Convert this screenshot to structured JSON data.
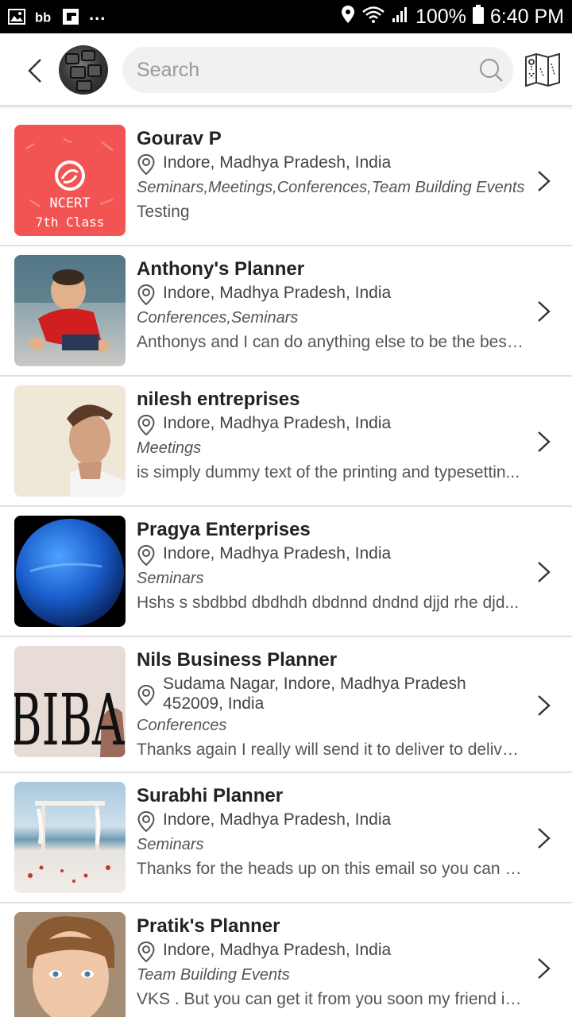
{
  "status_bar": {
    "battery": "100%",
    "time": "6:40 PM",
    "left_icons": [
      "image-icon",
      "bb-icon",
      "flipboard-icon",
      "more-dots"
    ],
    "more": "..."
  },
  "header": {
    "search": {
      "placeholder": "Search",
      "value": ""
    },
    "icons": [
      "back-icon",
      "profile-avatar",
      "search-icon",
      "map-icon"
    ]
  },
  "planners": [
    {
      "name": "Gourav  P",
      "location": "Indore, Madhya Pradesh, India",
      "categories": "Seminars,Meetings,Conferences,Team Building Events",
      "description": "Testing",
      "thumb_text_1": "NCERT",
      "thumb_text_2": "7th Class"
    },
    {
      "name": "Anthony's Planner",
      "location": "Indore, Madhya Pradesh, India",
      "categories": "Conferences,Seminars",
      "description": "Anthonys and I can do anything else to be the best..."
    },
    {
      "name": "nilesh entreprises",
      "location": "Indore, Madhya Pradesh, India",
      "categories": "Meetings",
      "description": "is simply dummy text of the printing and typesettin..."
    },
    {
      "name": "Pragya Enterprises",
      "location": "Indore, Madhya Pradesh, India",
      "categories": "Seminars",
      "description": "Hshs s sbdbbd dbdhdh dbdnnd dndnd djjd rhe djd..."
    },
    {
      "name": "Nils Business Planner",
      "location": "Sudama Nagar, Indore, Madhya Pradesh 452009, India",
      "categories": "Conferences",
      "description": "Thanks again I really will send it to deliver to deliver...",
      "thumb_text_1": "BIBA"
    },
    {
      "name": "Surabhi Planner",
      "location": "Indore, Madhya Pradesh, India",
      "categories": "Seminars",
      "description": "Thanks for the heads up on this email so you can g..."
    },
    {
      "name": "Pratik's Planner",
      "location": "Indore, Madhya Pradesh, India",
      "categories": "Team Building Events",
      "description": "VKS . But you can get it from you soon my friend is..."
    }
  ],
  "colors": {
    "ncert_red": "#f25454",
    "divider": "#e0e0e0",
    "search_bg": "#f1f1f1",
    "text_dark": "#222222"
  }
}
